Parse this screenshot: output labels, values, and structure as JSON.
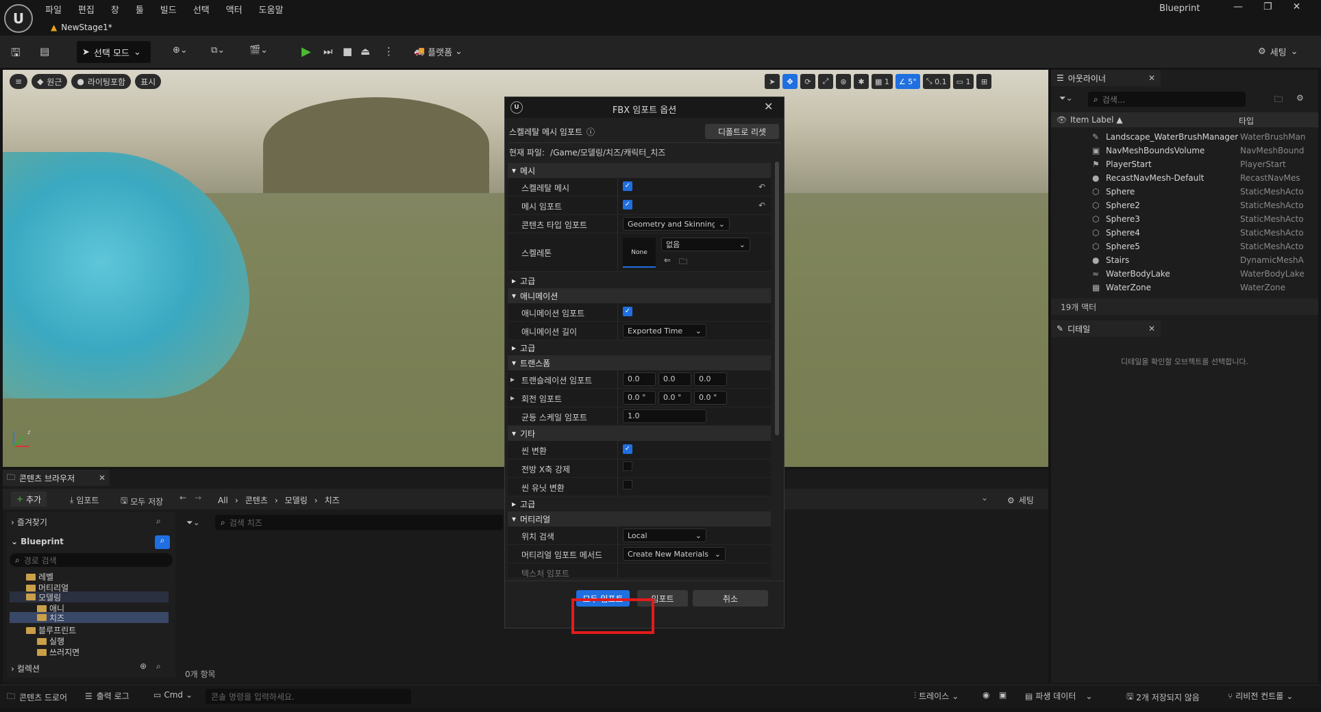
{
  "titlebar": {
    "menus": [
      "파일",
      "편집",
      "창",
      "툴",
      "빌드",
      "선택",
      "액터",
      "도움말"
    ],
    "doc_tab": "NewStage1*",
    "app_title": "Blueprint",
    "window_buttons": [
      "—",
      "❐",
      "✕"
    ]
  },
  "toolbar": {
    "mode_label": "선택 모드",
    "platform_label": "플랫폼",
    "settings_label": "세팅"
  },
  "viewport": {
    "left_pills": [
      "원근",
      "라이팅포함",
      "표시"
    ],
    "right_values": [
      "5°",
      "0.1",
      "1",
      "1"
    ]
  },
  "outliner": {
    "tab": "아웃라이너",
    "search_placeholder": "검색...",
    "col_label": "Item Label ▲",
    "col_type": "타입",
    "items": [
      {
        "name": "Landscape_WaterBrushManager",
        "type": "WaterBrushMan"
      },
      {
        "name": "NavMeshBoundsVolume",
        "type": "NavMeshBound"
      },
      {
        "name": "PlayerStart",
        "type": "PlayerStart"
      },
      {
        "name": "RecastNavMesh-Default",
        "type": "RecastNavMes"
      },
      {
        "name": "Sphere",
        "type": "StaticMeshActo"
      },
      {
        "name": "Sphere2",
        "type": "StaticMeshActo"
      },
      {
        "name": "Sphere3",
        "type": "StaticMeshActo"
      },
      {
        "name": "Sphere4",
        "type": "StaticMeshActo"
      },
      {
        "name": "Sphere5",
        "type": "StaticMeshActo"
      },
      {
        "name": "Stairs",
        "type": "DynamicMeshA"
      },
      {
        "name": "WaterBodyLake",
        "type": "WaterBodyLake"
      },
      {
        "name": "WaterZone",
        "type": "WaterZone"
      }
    ],
    "count": "19개 액터"
  },
  "details": {
    "tab": "디테일",
    "message": "디테일을 확인할 오브젝트를 선택합니다."
  },
  "content_browser": {
    "tab": "콘텐츠 브라우저",
    "add": "추가",
    "import": "임포트",
    "save_all": "모두 저장",
    "breadcrumb": [
      "All",
      "콘텐츠",
      "모델링",
      "치즈"
    ],
    "settings": "세팅",
    "favorites": "즐겨찾기",
    "root": "Blueprint",
    "path_search_placeholder": "경로 검색",
    "asset_search_placeholder": "검색 치즈",
    "tree": [
      "레벨",
      "머티리얼",
      "모델링",
      "애니",
      "치즈",
      "블루프린트",
      "실행",
      "쓰러지면"
    ],
    "collections": "컬렉션",
    "item_count": "0개 항목"
  },
  "statusbar": {
    "content_drawer": "콘텐츠 드로어",
    "output_log": "출력 로그",
    "cmd": "Cmd",
    "cmd_placeholder": "콘솔 명령을 입력하세요.",
    "trace": "트레이스",
    "derived_data": "파생 데이터",
    "unsaved": "2개 저장되지 않음",
    "revision_control": "리비전 컨트롤"
  },
  "dialog": {
    "title": "FBX 임포트 옵션",
    "import_type": "스켈레탈 메시 임포트",
    "reset_defaults": "디폴트로 리셋",
    "current_file_label": "현재 파일:",
    "current_file": "/Game/모델링/치즈/캐릭터_치즈",
    "sections": {
      "mesh": "메시",
      "advanced": "고급",
      "animation": "애니메이션",
      "transform": "트랜스폼",
      "misc": "기타",
      "material": "머티리얼"
    },
    "rows": {
      "skeletal_mesh": "스켈레탈 메시",
      "import_mesh": "메시 임포트",
      "content_type": "콘텐츠 타입 임포트",
      "content_type_value": "Geometry and Skinning Weights",
      "skeleton": "스켈레톤",
      "skeleton_thumb": "None",
      "skeleton_value": "없음",
      "import_anim": "애니메이션 임포트",
      "anim_length": "애니메이션 길이",
      "anim_length_value": "Exported Time",
      "translation": "트랜슬레이션 임포트",
      "translation_values": [
        "0.0",
        "0.0",
        "0.0"
      ],
      "rotation": "회전 임포트",
      "rotation_values": [
        "0.0 °",
        "0.0 °",
        "0.0 °"
      ],
      "uniform_scale": "균등 스케일 임포트",
      "uniform_scale_value": "1.0",
      "convert_scene": "씬 변환",
      "force_front_x": "전방 X축 강제",
      "convert_scene_unit": "씬 유닛 변환",
      "search_location": "위치 검색",
      "search_location_value": "Local",
      "material_import_method": "머티리얼 임포트 메서드",
      "material_import_value": "Create New Materials",
      "texture_import": "텍스처 임포트"
    },
    "buttons": {
      "import_all": "모두 임포트",
      "import": "임포트",
      "cancel": "취소"
    }
  },
  "colors": {
    "accent": "#1f6fe0",
    "highlight": "#e41b1b"
  }
}
